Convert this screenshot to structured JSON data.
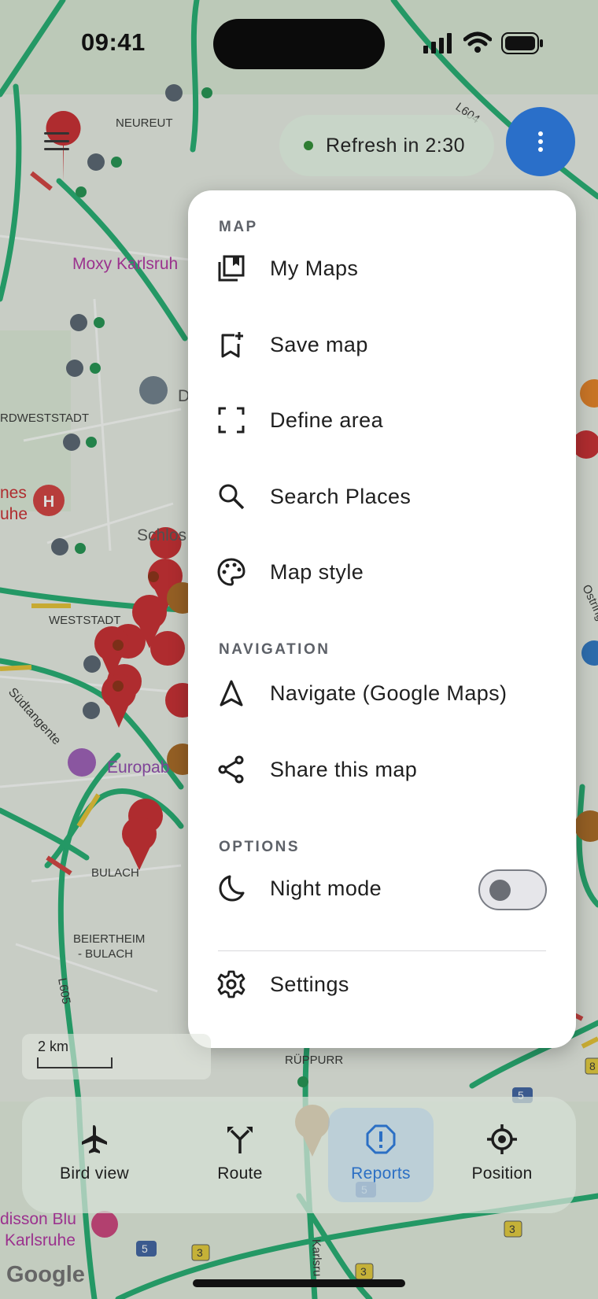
{
  "status_bar": {
    "time": "09:41"
  },
  "map": {
    "labels": {
      "neureut": "NEUREUT",
      "moxy": "Moxy Karlsruh",
      "nordweststadt": "RDWESTSTADT",
      "hospital_a": "nes",
      "hospital_b": "uhe",
      "schloss": "Schlos",
      "weststadt": "WESTSTADT",
      "suedtangente": "Südtangente",
      "europab": "Europab",
      "bulach": "BULACH",
      "beiertheim_a": "BEIERTHEIM",
      "beiertheim_b": "- BULACH",
      "l605": "L605",
      "l604": "L604",
      "rueppurr": "RÜPPURR",
      "radisson_a": "disson Blu",
      "radisson_b": "Karlsruhe",
      "karlsruhe_road": "Karlsru",
      "ostring": "Ostring",
      "d_label": "D",
      "road_5a": "5",
      "road_5b": "5",
      "road_5c": "5",
      "road_3a": "3",
      "road_3b": "3",
      "road_3c": "3",
      "road_8": "8"
    },
    "scale_label": "2 km",
    "attribution": "Google"
  },
  "header": {
    "refresh_label": "Refresh in 2:30",
    "refresh_color": "#2e7d32",
    "fab_color": "#2a6fc9"
  },
  "menu": {
    "sections": {
      "map": "MAP",
      "navigation": "NAVIGATION",
      "options": "OPTIONS"
    },
    "items": {
      "my_maps": {
        "label": "My Maps",
        "icon": "collections-bookmark-icon"
      },
      "save_map": {
        "label": "Save map",
        "icon": "bookmark-add-icon"
      },
      "define_area": {
        "label": "Define area",
        "icon": "crop-free-icon"
      },
      "search_places": {
        "label": "Search Places",
        "icon": "search-icon"
      },
      "map_style": {
        "label": "Map style",
        "icon": "palette-icon"
      },
      "navigate": {
        "label": "Navigate (Google Maps)",
        "icon": "navigation-arrow-icon"
      },
      "share": {
        "label": "Share this map",
        "icon": "share-icon"
      },
      "night_mode": {
        "label": "Night mode",
        "icon": "moon-icon",
        "enabled": false
      },
      "settings": {
        "label": "Settings",
        "icon": "gear-icon"
      }
    }
  },
  "bottom_nav": {
    "tabs": [
      {
        "label": "Bird view",
        "icon": "airplane-icon",
        "active": false
      },
      {
        "label": "Route",
        "icon": "route-fork-icon",
        "active": false
      },
      {
        "label": "Reports",
        "icon": "report-alert-icon",
        "active": true
      },
      {
        "label": "Position",
        "icon": "my-location-icon",
        "active": false
      }
    ],
    "active_color": "#2b6fc4"
  }
}
